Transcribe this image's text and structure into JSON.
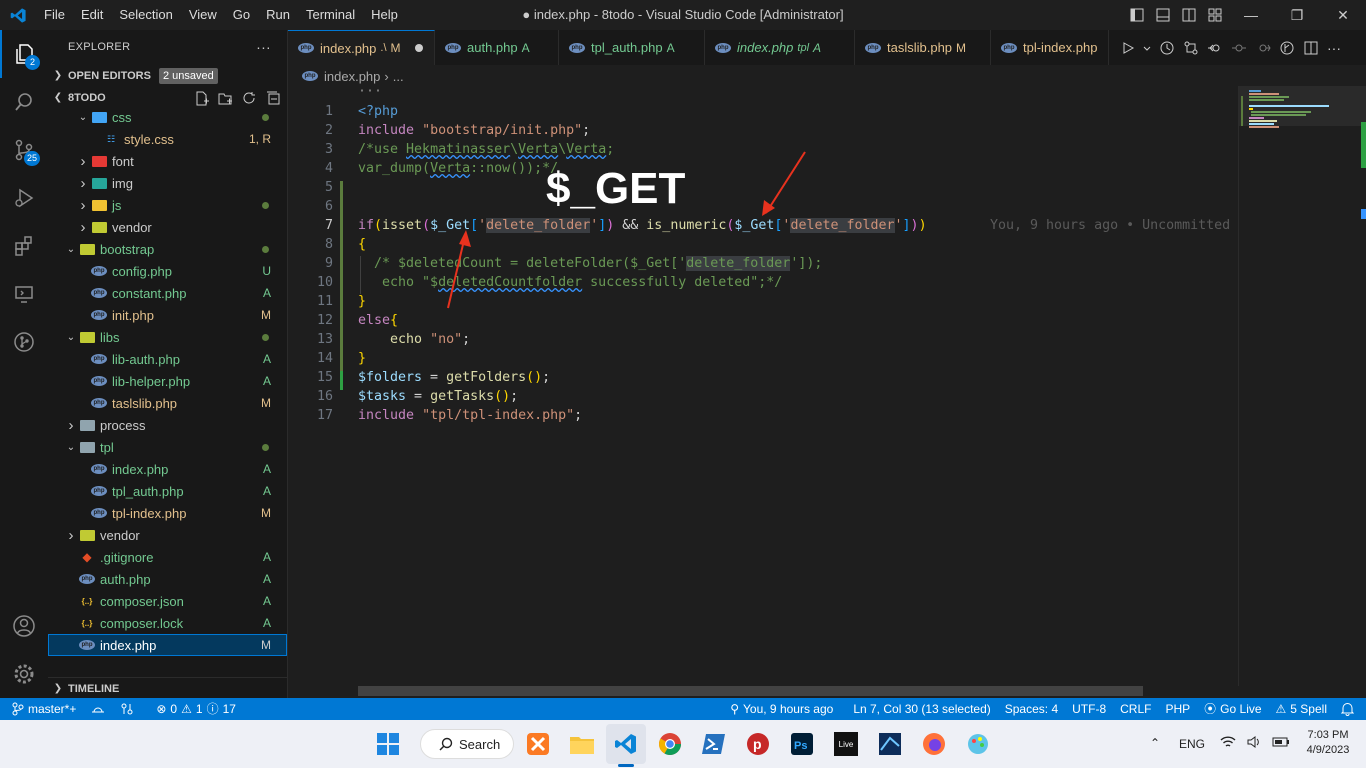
{
  "window": {
    "title": "● index.php - 8todo - Visual Studio Code [Administrator]",
    "menu": [
      "File",
      "Edit",
      "Selection",
      "View",
      "Go",
      "Run",
      "Terminal",
      "Help"
    ]
  },
  "activity": {
    "explorer_badge": "2",
    "scm_badge": "25"
  },
  "sidebar": {
    "header": "EXPLORER",
    "more": "···",
    "open_editors": "OPEN EDITORS",
    "unsaved_badge": "2 unsaved",
    "project": "8TODO",
    "timeline": "TIMELINE",
    "tree": [
      {
        "label": "css",
        "status": "",
        "dot": true
      },
      {
        "label": "style.css",
        "status": "1, R"
      },
      {
        "label": "font",
        "status": ""
      },
      {
        "label": "img",
        "status": ""
      },
      {
        "label": "js",
        "status": "",
        "dot": true
      },
      {
        "label": "vendor",
        "status": ""
      },
      {
        "label": "bootstrap",
        "status": "",
        "dot": true
      },
      {
        "label": "config.php",
        "status": "U"
      },
      {
        "label": "constant.php",
        "status": "A"
      },
      {
        "label": "init.php",
        "status": "M"
      },
      {
        "label": "libs",
        "status": "",
        "dot": true
      },
      {
        "label": "lib-auth.php",
        "status": "A"
      },
      {
        "label": "lib-helper.php",
        "status": "A"
      },
      {
        "label": "taslslib.php",
        "status": "M"
      },
      {
        "label": "process",
        "status": ""
      },
      {
        "label": "tpl",
        "status": "",
        "dot": true
      },
      {
        "label": "index.php",
        "status": "A"
      },
      {
        "label": "tpl_auth.php",
        "status": "A"
      },
      {
        "label": "tpl-index.php",
        "status": "M"
      },
      {
        "label": "vendor",
        "status": ""
      },
      {
        "label": ".gitignore",
        "status": "A"
      },
      {
        "label": "auth.php",
        "status": "A"
      },
      {
        "label": "composer.json",
        "status": "A"
      },
      {
        "label": "composer.lock",
        "status": "A"
      },
      {
        "label": "index.php",
        "status": "M"
      }
    ]
  },
  "tabs": [
    {
      "label": "index.php",
      "desc": ".\\",
      "status": "M"
    },
    {
      "label": "auth.php",
      "status": "A"
    },
    {
      "label": "tpl_auth.php",
      "status": "A"
    },
    {
      "label": "index.php",
      "desc": "tpl",
      "status": "A"
    },
    {
      "label": "taslslib.php",
      "status": "M"
    },
    {
      "label": "tpl-index.php",
      "status": ""
    }
  ],
  "breadcrumb": {
    "file": "index.php",
    "more": "..."
  },
  "editor": {
    "overlay_text": "$_GET",
    "blame": "You, 9 hours ago • Uncommitted",
    "ellipsis": "···",
    "line_numbers": [
      "1",
      "2",
      "3",
      "4",
      "5",
      "6",
      "7",
      "8",
      "9",
      "10",
      "11",
      "12",
      "13",
      "14",
      "15",
      "16",
      "17"
    ]
  },
  "statusbar": {
    "branch": "master*+",
    "errors": "0",
    "warnings": "1",
    "infos": "17",
    "blame": "You, 9 hours ago",
    "position": "Ln 7, Col 30 (13 selected)",
    "spaces": "Spaces: 4",
    "encoding": "UTF-8",
    "eol": "CRLF",
    "language": "PHP",
    "golive": "Go Live",
    "spell": "5 Spell"
  },
  "taskbar": {
    "search": "Search",
    "live": "Live",
    "lang": "ENG",
    "time": "7:03 PM",
    "date": "4/9/2023"
  },
  "colors": {
    "accent": "#0078d4",
    "annotation_arrow": "#e8321e"
  }
}
